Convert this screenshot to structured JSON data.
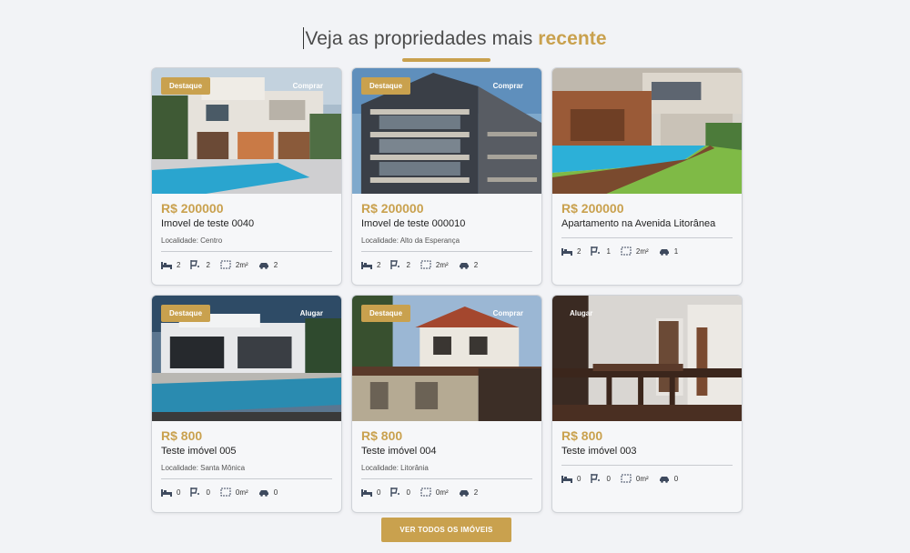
{
  "section": {
    "title_prefix": "Veja as propriedades mais ",
    "title_accent": "recente"
  },
  "colors": {
    "accent": "#c9a14e",
    "background": "#f2f3f6"
  },
  "cards": [
    {
      "badge": "Destaque",
      "deal": "Comprar",
      "price": "R$ 200000",
      "name": "Imovel de teste 0040",
      "location": "Localidade: Centro",
      "beds": "2",
      "baths": "2",
      "area": "2m²",
      "cars": "2"
    },
    {
      "badge": "Destaque",
      "deal": "Comprar",
      "price": "R$ 200000",
      "name": "Imovel de teste 000010",
      "location": "Localidade: Alto da Esperança",
      "beds": "2",
      "baths": "2",
      "area": "2m²",
      "cars": "2"
    },
    {
      "badge": "",
      "deal": "",
      "price": "R$ 200000",
      "name": "Apartamento na Avenida Litorânea",
      "location": "",
      "beds": "2",
      "baths": "1",
      "area": "2m²",
      "cars": "1"
    },
    {
      "badge": "Destaque",
      "deal": "Alugar",
      "price": "R$ 800",
      "name": "Teste imóvel 005",
      "location": "Localidade: Santa Mônica",
      "beds": "0",
      "baths": "0",
      "area": "0m²",
      "cars": "0"
    },
    {
      "badge": "Destaque",
      "deal": "Comprar",
      "price": "R$ 800",
      "name": "Teste imóvel 004",
      "location": "Localidade: Litorânia",
      "beds": "0",
      "baths": "0",
      "area": "0m²",
      "cars": "2"
    },
    {
      "badge": "",
      "deal": "Alugar",
      "price": "R$ 800",
      "name": "Teste imóvel 003",
      "location": "",
      "beds": "0",
      "baths": "0",
      "area": "0m²",
      "cars": "0"
    }
  ],
  "icons": [
    "bed-icon",
    "bath-icon",
    "area-icon",
    "car-icon"
  ],
  "cta": {
    "label": "VER TODOS OS IMÓVEIS"
  }
}
